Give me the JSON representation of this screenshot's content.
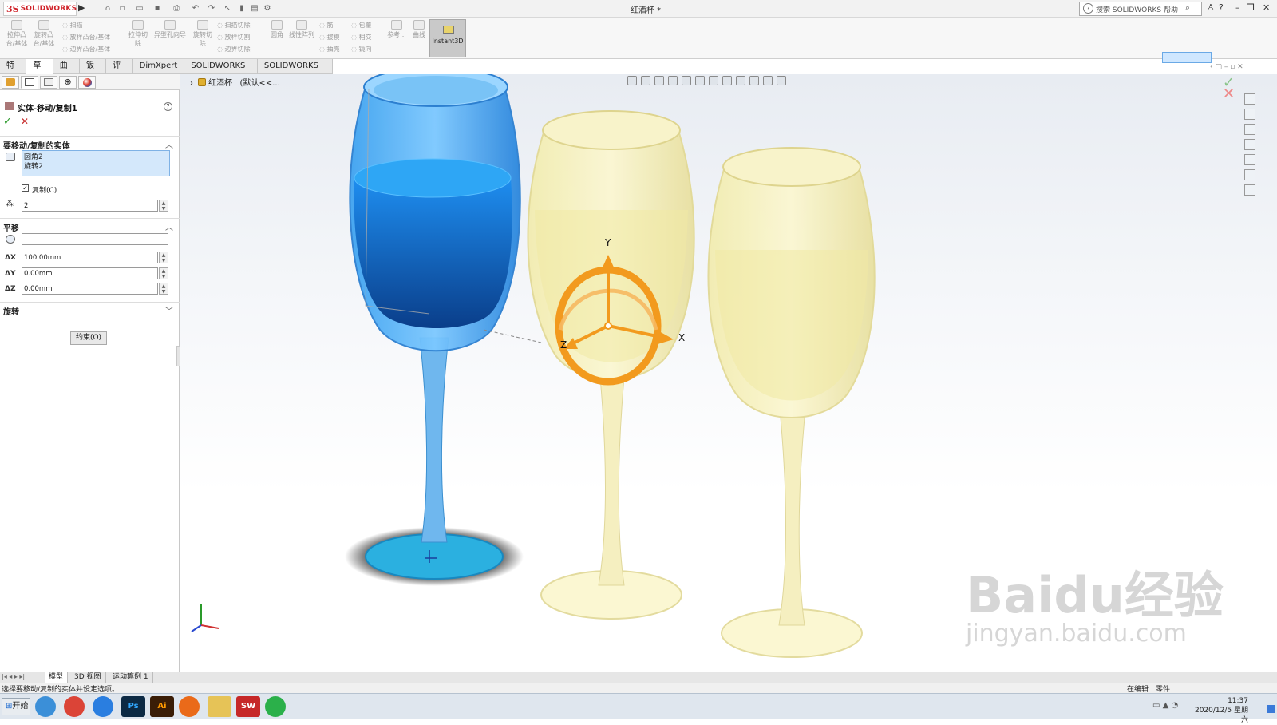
{
  "app": {
    "brand_ds": "3S",
    "brand_name": "SOLIDWORKS",
    "document_title": "红酒杯 *",
    "search_placeholder": "搜索 SOLIDWORKS 帮助"
  },
  "ribbon": {
    "buttons": [
      {
        "label": "拉伸凸\n台/基体",
        "icon": "extrude-boss-icon"
      },
      {
        "label": "旋转凸\n台/基体",
        "icon": "revolve-boss-icon"
      },
      {
        "label": "扫描",
        "icon": "sweep-icon"
      },
      {
        "label": "放样凸台/基体",
        "icon": "loft-icon"
      },
      {
        "label": "边界凸台/基体",
        "icon": "boundary-boss-icon"
      },
      {
        "label": "拉伸切\n除",
        "icon": "extrude-cut-icon"
      },
      {
        "label": "异型孔向导",
        "icon": "hole-wizard-icon"
      },
      {
        "label": "旋转切\n除",
        "icon": "revolve-cut-icon"
      },
      {
        "label": "扫描切除",
        "icon": "swept-cut-icon"
      },
      {
        "label": "放样切割",
        "icon": "lofted-cut-icon"
      },
      {
        "label": "边界切除",
        "icon": "boundary-cut-icon"
      },
      {
        "label": "圆角",
        "icon": "fillet-icon"
      },
      {
        "label": "线性阵列",
        "icon": "linear-pattern-icon"
      },
      {
        "label": "筋",
        "icon": "rib-icon"
      },
      {
        "label": "拔模",
        "icon": "draft-icon"
      },
      {
        "label": "抽壳",
        "icon": "shell-icon"
      },
      {
        "label": "包覆",
        "icon": "wrap-icon"
      },
      {
        "label": "相交",
        "icon": "intersect-icon"
      },
      {
        "label": "镜向",
        "icon": "mirror-icon"
      },
      {
        "label": "参考...",
        "icon": "reference-geometry-icon"
      },
      {
        "label": "曲线",
        "icon": "curves-icon"
      }
    ],
    "instant3d_label": "Instant3D"
  },
  "tabs": [
    "特征",
    "草图",
    "曲面",
    "钣件",
    "评估",
    "DimXpert",
    "SOLIDWORKS 插件",
    "SOLIDWORKS MBD"
  ],
  "active_tab_index": 0,
  "feature_tree": {
    "part_name": "红酒杯",
    "config": "(默认<<..."
  },
  "property_manager": {
    "title": "实体-移动/复制1",
    "section_bodies": "要移动/复制的实体",
    "selected_bodies": [
      "圆角2",
      "旋转2"
    ],
    "copy_checkbox_label": "复制(C)",
    "copy_checked": true,
    "copy_count": "2",
    "section_translate": "平移",
    "translate_ref": "",
    "dx_label": "ΔX",
    "dx_value": "100.00mm",
    "dy_label": "ΔY",
    "dy_value": "0.00mm",
    "dz_label": "ΔZ",
    "dz_value": "0.00mm",
    "section_rotate": "旋转",
    "constraint_button": "约束(O)"
  },
  "triad_labels": {
    "x": "X",
    "y": "Y",
    "z": "Z"
  },
  "bottom_tabs": [
    "模型",
    "3D 视图",
    "运动算例 1"
  ],
  "active_bottom_tab_index": 0,
  "status": {
    "message": "选择要移动/复制的实体并设定选项。",
    "mode": "在编辑",
    "mode_target": "零件"
  },
  "taskbar": {
    "start_label": "开始",
    "apps": [
      {
        "name": "browser-360",
        "label": "",
        "color": "#3b8fd8"
      },
      {
        "name": "chrome",
        "label": "",
        "color": "#db4437"
      },
      {
        "name": "baidu-netdisk",
        "label": "",
        "color": "#2a7ee0"
      },
      {
        "name": "photoshop",
        "label": "Ps",
        "color": "#0c2a44"
      },
      {
        "name": "illustrator",
        "label": "Ai",
        "color": "#3a1d06"
      },
      {
        "name": "firefox",
        "label": "",
        "color": "#ea6a19"
      },
      {
        "name": "file-explorer",
        "label": "",
        "color": "#e6c357"
      },
      {
        "name": "solidworks",
        "label": "SW",
        "color": "#c62828"
      },
      {
        "name": "wechat",
        "label": "",
        "color": "#2bb04a"
      }
    ],
    "time": "11:37",
    "date": "2020/12/5 星期六"
  },
  "watermark": {
    "text": "Baidu经验",
    "url": "jingyan.baidu.com"
  }
}
